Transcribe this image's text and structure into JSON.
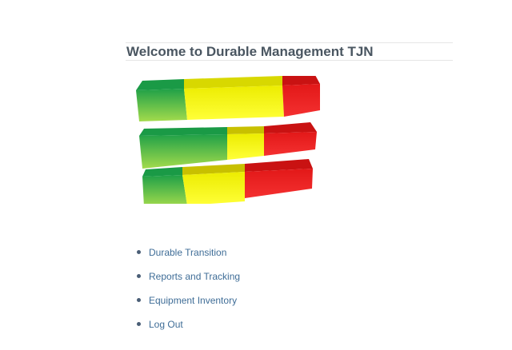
{
  "header": {
    "title": "Welcome to Durable Management TJN"
  },
  "logo": {
    "icon": "status-bars-logo-icon",
    "colors": {
      "green": "#3ab84a",
      "yellow": "#f2f200",
      "red": "#e41b1b"
    }
  },
  "nav": {
    "items": [
      {
        "label": "Durable Transition"
      },
      {
        "label": "Reports and Tracking"
      },
      {
        "label": "Equipment Inventory"
      },
      {
        "label": "Log Out"
      }
    ]
  }
}
